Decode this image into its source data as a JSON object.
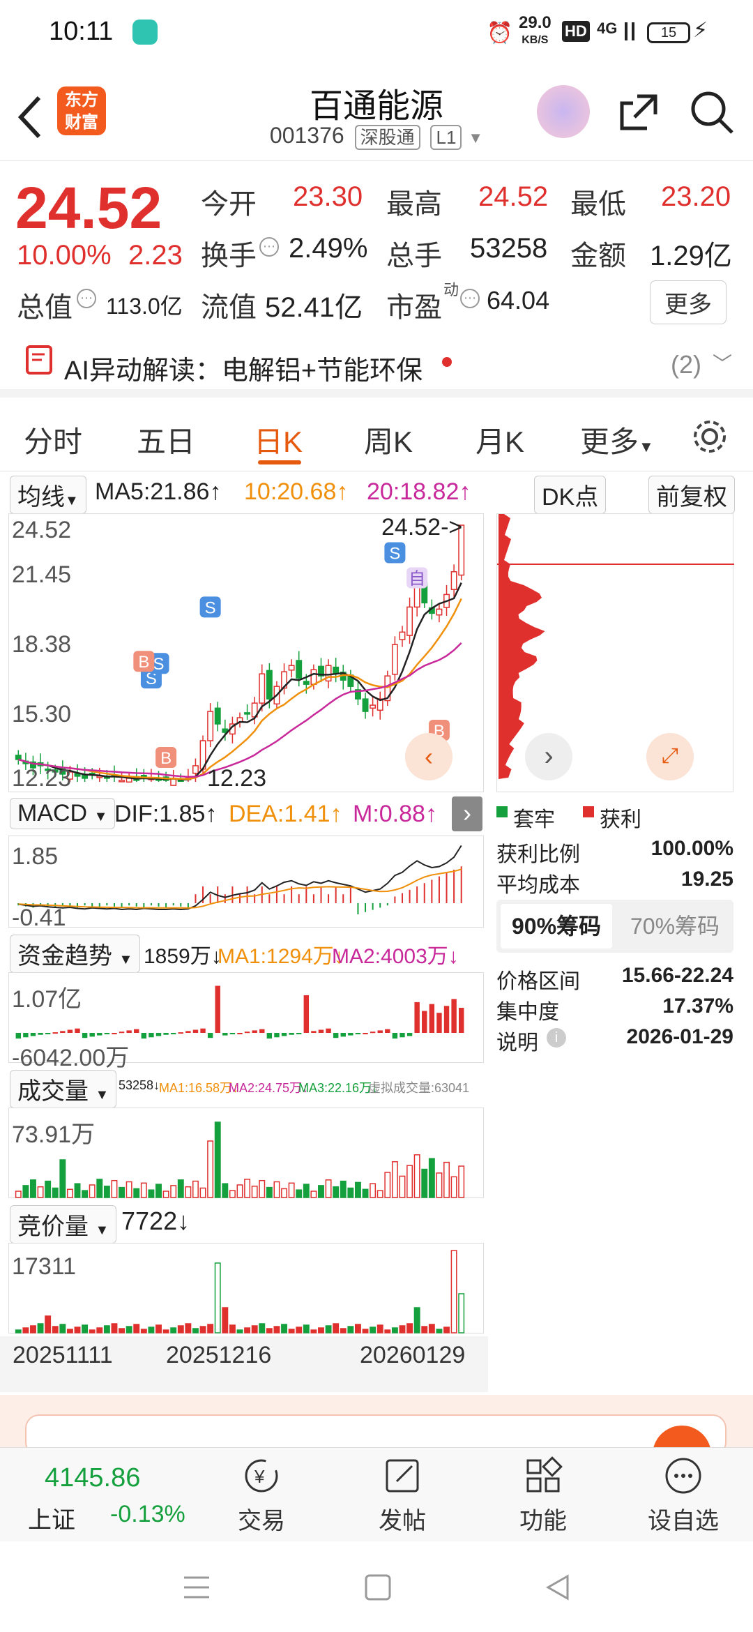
{
  "status_bar": {
    "time": "10:11",
    "net_speed_value": "29.0",
    "net_speed_unit": "KB/S",
    "hd": "HD",
    "signal": "4G",
    "battery": "15"
  },
  "header": {
    "back_icon": "chevron-left-icon",
    "logo_line1": "东方",
    "logo_line2": "财富",
    "stock_name": "百通能源",
    "stock_code": "001376",
    "tag_market": "深股通",
    "tag_level": "L1",
    "share_icon": "share-icon",
    "search_icon": "search-icon"
  },
  "quote": {
    "price": "24.52",
    "change_pct": "10.00%",
    "change": "2.23",
    "open_label": "今开",
    "open": "23.30",
    "high_label": "最高",
    "high": "24.52",
    "low_label": "最低",
    "low": "23.20",
    "turnover_label": "换手",
    "turnover": "2.49%",
    "volume_label": "总手",
    "volume": "53258",
    "amount_label": "金额",
    "amount": "1.29亿",
    "total_cap_label": "总值",
    "total_cap": "113.0亿",
    "float_cap_label": "流值",
    "float_cap": "52.41亿",
    "pe_label": "市盈",
    "pe_sup": "动",
    "pe": "64.04",
    "more": "更多"
  },
  "ai_bar": {
    "text": "AI异动解读：电解铝+节能环保",
    "count": "(2)"
  },
  "tabs": [
    "分时",
    "五日",
    "日K",
    "周K",
    "月K",
    "更多"
  ],
  "active_tab": 2,
  "ma_bar": {
    "selector": "均线",
    "ma5": "MA5:21.86",
    "ma10": "10:20.68",
    "ma20": "20:18.82",
    "dk": "DK点",
    "adjust": "前复权"
  },
  "kline": {
    "y_ticks": [
      "24.52",
      "21.45",
      "18.38",
      "15.30",
      "12.23"
    ],
    "max_label": "24.52->",
    "min_label": "12.23",
    "markers": [
      "自",
      "S",
      "B"
    ]
  },
  "chart_data": {
    "type": "candlestick",
    "ylim": [
      12.23,
      24.52
    ],
    "closes": [
      13.3,
      13.1,
      12.9,
      13.0,
      12.8,
      12.7,
      12.6,
      12.7,
      12.5,
      12.4,
      12.6,
      12.5,
      12.4,
      12.5,
      12.3,
      12.4,
      12.3,
      12.5,
      12.4,
      12.3,
      12.3,
      12.4,
      12.3,
      12.4,
      13.0,
      14.2,
      15.6,
      15.0,
      14.6,
      15.0,
      15.3,
      15.5,
      16.0,
      17.4,
      16.2,
      16.8,
      17.5,
      17.8,
      17.2,
      16.9,
      17.6,
      17.3,
      17.8,
      17.4,
      17.1,
      16.8,
      16.2,
      15.6,
      15.9,
      16.2,
      17.3,
      18.8,
      19.4,
      20.6,
      21.6,
      20.8,
      20.3,
      20.5,
      21.2,
      22.29,
      24.52
    ],
    "dates": [
      "20251111",
      "20251216",
      "20260129"
    ]
  },
  "chips": {
    "legend_hold": "套牢",
    "legend_profit": "获利",
    "profit_ratio_label": "获利比例",
    "profit_ratio": "100.00%",
    "avg_cost_label": "平均成本",
    "avg_cost": "19.25",
    "tab90": "90%筹码",
    "tab70": "70%筹码",
    "range_label": "价格区间",
    "range": "15.66-22.24",
    "concentration_label": "集中度",
    "concentration": "17.37%",
    "note_label": "说明",
    "note": "2026-01-29"
  },
  "macd": {
    "selector": "MACD",
    "dif": "DIF:1.85",
    "dea": "DEA:1.41",
    "m": "M:0.88",
    "top": "1.85",
    "bottom": "-0.41"
  },
  "fund": {
    "selector": "资金趋势",
    "value": "1859万",
    "ma1": "MA1:1294万",
    "ma2": "MA2:4003万",
    "top": "1.07亿",
    "bottom": "-6042.00万"
  },
  "vol": {
    "selector": "成交量",
    "value": "53258",
    "ma1": "MA1:16.58万",
    "ma2": "MA2:24.75万",
    "ma3": "MA3:22.16万",
    "virtual": "虚拟成交量:63041",
    "top": "73.91万"
  },
  "auction": {
    "selector": "竞价量",
    "value": "7722",
    "top": "17311"
  },
  "dates": [
    "20251111",
    "20251216",
    "20260129"
  ],
  "bottom_nav": {
    "index_value": "4145.86",
    "index_name": "上证",
    "index_change": "-0.13%",
    "trade": "交易",
    "post": "发帖",
    "func": "功能",
    "watch": "设自选"
  }
}
